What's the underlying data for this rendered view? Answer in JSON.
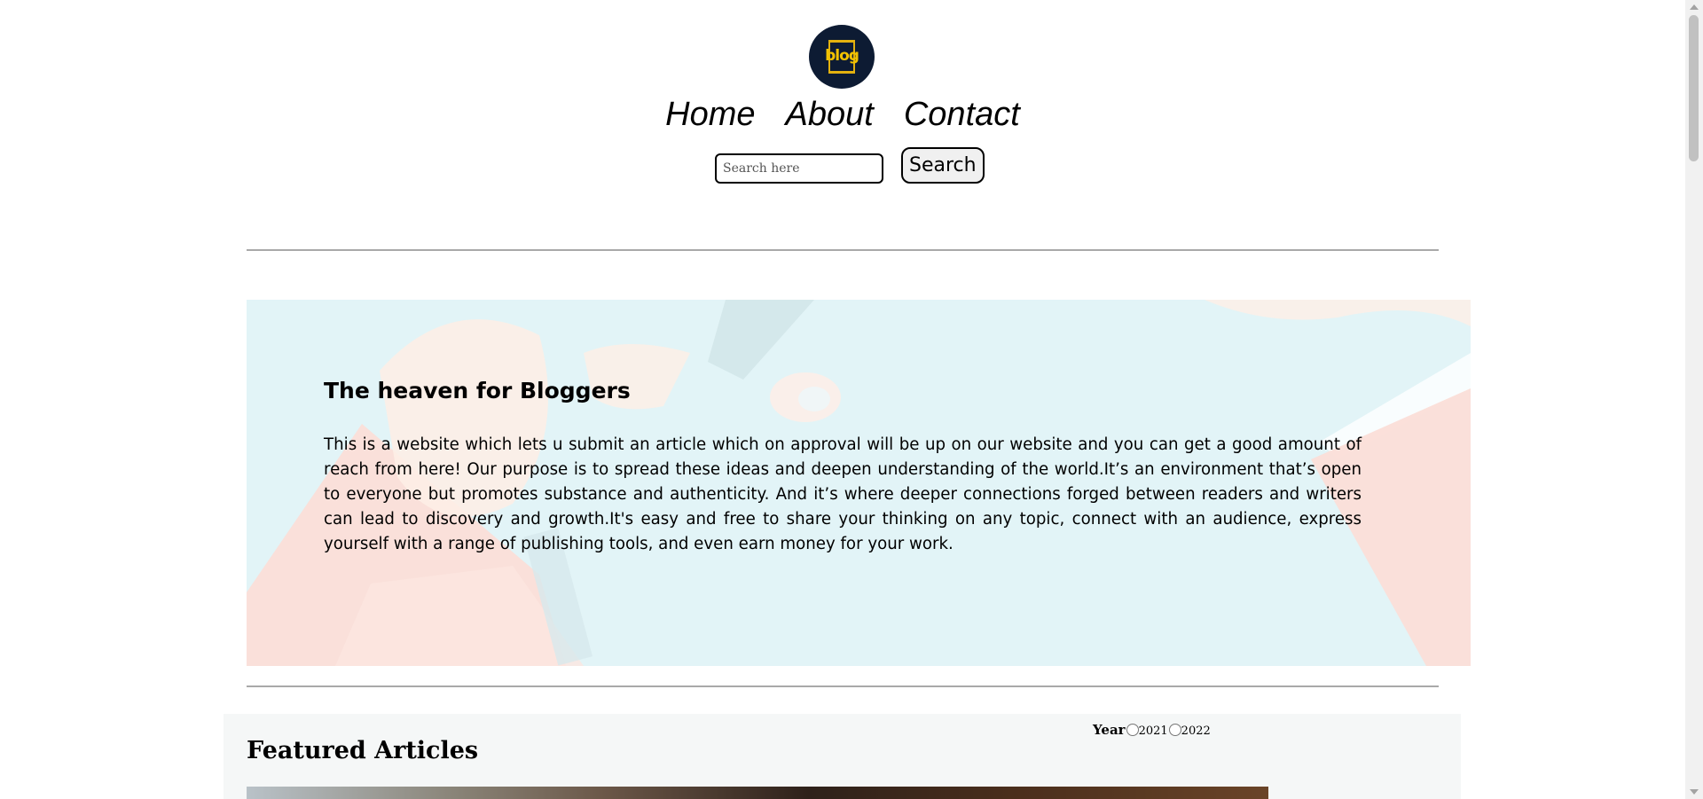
{
  "header": {
    "logo_text": "blog",
    "nav": [
      {
        "label": "Home"
      },
      {
        "label": "About"
      },
      {
        "label": "Contact"
      }
    ],
    "search": {
      "placeholder": "Search here",
      "button_label": "Search"
    }
  },
  "hero": {
    "title": "The heaven for Bloggers",
    "text": "This is a website which lets u submit an article which on approval will be up on our website and you can get a good amount of reach from here! Our purpose is to spread these ideas and deepen understanding of the world.It’s an environment that’s open to everyone but promotes substance and authenticity. And it’s where deeper connections forged between readers and writers can lead to discovery and growth.It's easy and free to share your thinking on any topic, connect with an audience, express yourself with a range of publishing tools, and even earn money for your work."
  },
  "featured": {
    "title": "Featured Articles",
    "year_filter": {
      "label": "Year",
      "options": [
        "2021",
        "2022"
      ]
    }
  },
  "colors": {
    "logo_bg": "#0d1b33",
    "logo_accent": "#f2c200",
    "hero_bg": "#e2f4f7",
    "hero_pink": "#fbded8",
    "featured_bg": "#f5f7f7"
  }
}
